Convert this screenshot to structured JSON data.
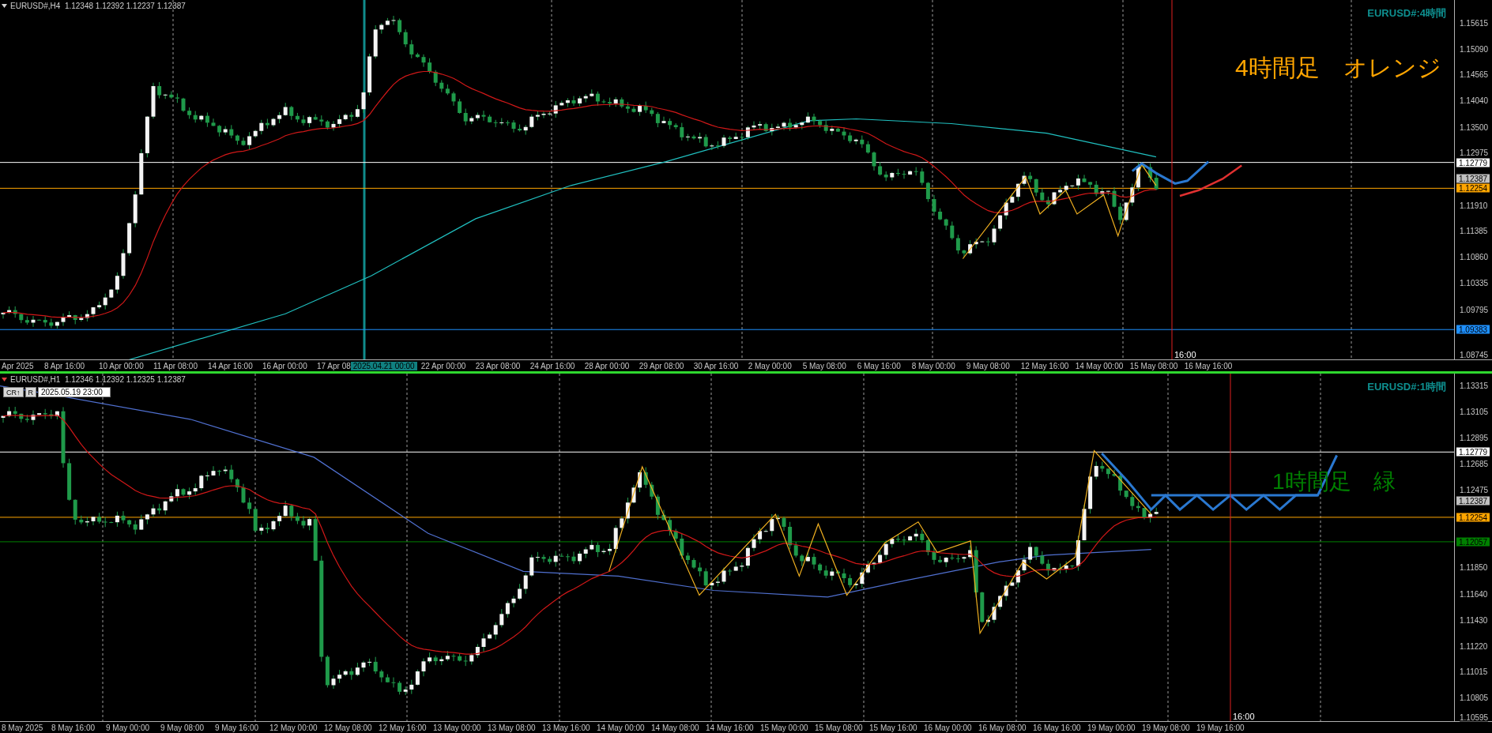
{
  "panels": [
    {
      "header": "EURUSD#,H4  1.12348 1.12392 1.12237 1.12387",
      "title": "EURUSD#:4時間",
      "note": "4時間足　オレンジ",
      "color": "#ffa500",
      "active": false,
      "price_ticks": [
        "1.15615",
        "1.15090",
        "1.14565",
        "1.14040",
        "1.13500",
        "1.12975",
        "1.11910",
        "1.11385",
        "1.10860",
        "1.10335",
        "1.09795",
        "1.08745"
      ],
      "price_badges": [
        {
          "text": "1.12779",
          "kind": "level",
          "color": "#ffffff"
        },
        {
          "text": "1.12387",
          "kind": "price",
          "color": "#c0c0c0"
        },
        {
          "text": "1.12254",
          "kind": "level",
          "color": "#ffa500"
        },
        {
          "text": "1.09383",
          "kind": "level",
          "color": "#1e90ff"
        }
      ],
      "time_labels": [
        {
          "text": "Apr 2025",
          "kind": "label"
        },
        {
          "text": "8 Apr 16:00",
          "kind": "label"
        },
        {
          "text": "10 Apr 00:00",
          "kind": "label"
        },
        {
          "text": "11 Apr 08:00",
          "kind": "label"
        },
        {
          "text": "14 Apr 16:00",
          "kind": "label"
        },
        {
          "text": "16 Apr 00:00",
          "kind": "label"
        },
        {
          "text": "17 Apr 08",
          "kind": "cut"
        },
        {
          "text": "2025.04.21 00:00",
          "kind": "badge"
        },
        {
          "text": "22 Apr 00:00",
          "kind": "label"
        },
        {
          "text": "23 Apr 08:00",
          "kind": "label"
        },
        {
          "text": "24 Apr 16:00",
          "kind": "label"
        },
        {
          "text": "28 Apr 00:00",
          "kind": "label"
        },
        {
          "text": "29 Apr 08:00",
          "kind": "label"
        },
        {
          "text": "30 Apr 16:00",
          "kind": "label"
        },
        {
          "text": "2 May 00:00",
          "kind": "label"
        },
        {
          "text": "5 May 08:00",
          "kind": "label"
        },
        {
          "text": "6 May 16:00",
          "kind": "label"
        },
        {
          "text": "8 May 00:00",
          "kind": "label"
        },
        {
          "text": "9 May 08:00",
          "kind": "label"
        },
        {
          "text": "12 May 16:00",
          "kind": "label"
        },
        {
          "text": "14 May 00:00",
          "kind": "label"
        },
        {
          "text": "15 May 08:00",
          "kind": "label"
        },
        {
          "text": "16 May 16:00",
          "kind": "label"
        }
      ],
      "cursor_time": "16:00"
    },
    {
      "header": "EURUSD#,H1  1.12346 1.12392 1.12325 1.12387",
      "title": "EURUSD#:1時間",
      "note": "1時間足　緑",
      "color": "#008000",
      "active": true,
      "controls": {
        "buttons": [
          "CR↑",
          "R"
        ],
        "date_value": "2025.05.19 23:00"
      },
      "price_ticks": [
        "1.13315",
        "1.13105",
        "1.12895",
        "1.12685",
        "1.12475",
        "1.11850",
        "1.11640",
        "1.11430",
        "1.11220",
        "1.11015",
        "1.10805",
        "1.10595"
      ],
      "price_badges": [
        {
          "text": "1.12779",
          "kind": "level",
          "color": "#ffffff"
        },
        {
          "text": "1.12387",
          "kind": "price",
          "color": "#c0c0c0"
        },
        {
          "text": "1.12254",
          "kind": "level",
          "color": "#ffa500"
        },
        {
          "text": "1.12057",
          "kind": "level",
          "color": "#008000"
        }
      ],
      "time_labels": [
        {
          "text": "8 May 2025",
          "kind": "label"
        },
        {
          "text": "8 May 16:00",
          "kind": "label"
        },
        {
          "text": "9 May 00:00",
          "kind": "label"
        },
        {
          "text": "9 May 08:00",
          "kind": "label"
        },
        {
          "text": "9 May 16:00",
          "kind": "label"
        },
        {
          "text": "12 May 00:00",
          "kind": "label"
        },
        {
          "text": "12 May 08:00",
          "kind": "label"
        },
        {
          "text": "12 May 16:00",
          "kind": "label"
        },
        {
          "text": "13 May 00:00",
          "kind": "label"
        },
        {
          "text": "13 May 08:00",
          "kind": "label"
        },
        {
          "text": "13 May 16:00",
          "kind": "label"
        },
        {
          "text": "14 May 00:00",
          "kind": "label"
        },
        {
          "text": "14 May 08:00",
          "kind": "label"
        },
        {
          "text": "14 May 16:00",
          "kind": "label"
        },
        {
          "text": "15 May 00:00",
          "kind": "label"
        },
        {
          "text": "15 May 08:00",
          "kind": "label"
        },
        {
          "text": "15 May 16:00",
          "kind": "label"
        },
        {
          "text": "16 May 00:00",
          "kind": "label"
        },
        {
          "text": "16 May 08:00",
          "kind": "label"
        },
        {
          "text": "16 May 16:00",
          "kind": "label"
        },
        {
          "text": "19 May 00:00",
          "kind": "label"
        },
        {
          "text": "19 May 08:00",
          "kind": "label"
        },
        {
          "text": "19 May 16:00",
          "kind": "label"
        }
      ],
      "cursor_time": "16:00"
    }
  ]
}
